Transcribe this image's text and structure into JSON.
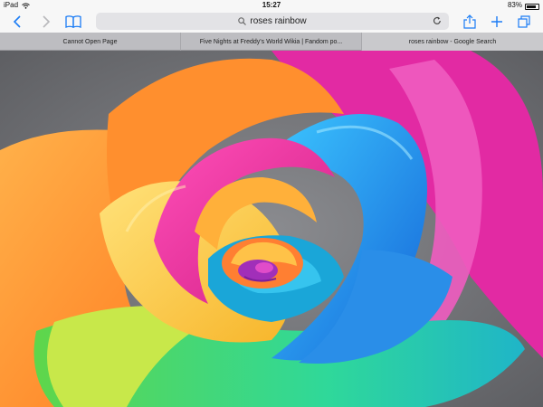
{
  "status_bar": {
    "device": "iPad",
    "time": "15:27",
    "battery": "83%",
    "battery_level": 0.83
  },
  "toolbar": {
    "search_text": "roses rainbow"
  },
  "tabs": [
    {
      "label": "Cannot Open Page"
    },
    {
      "label": "Five Nights at Freddy's World Wikia | Fandom po..."
    },
    {
      "label": "roses rainbow - Google Search"
    }
  ],
  "tab_close_glyph": "✕",
  "colors": {
    "toolbar_bg": "#f7f7f7",
    "tab_bar_bg": "#bdbdc1",
    "address_bg": "#e3e3e6"
  }
}
